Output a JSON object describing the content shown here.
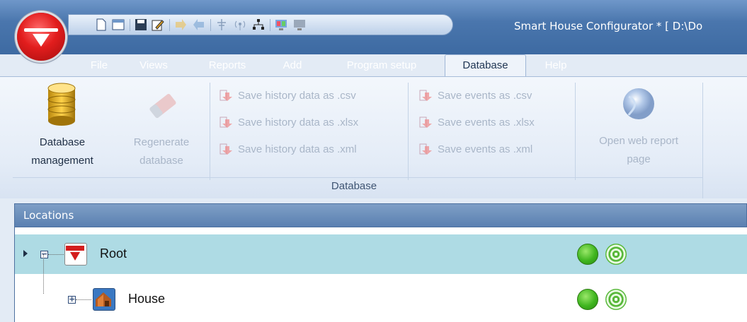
{
  "window": {
    "title": "Smart House Configurator * [ D:\\Do"
  },
  "qat": {
    "icons": [
      "new-document-icon",
      "open-icon",
      "save-icon",
      "edit-icon",
      "import-icon",
      "export-icon",
      "antenna-icon",
      "wireless-icon",
      "network-icon",
      "monitor-color-icon",
      "monitor-icon"
    ]
  },
  "menu": {
    "tabs": [
      {
        "label": "File"
      },
      {
        "label": "Views"
      },
      {
        "label": "Reports"
      },
      {
        "label": "Add"
      },
      {
        "label": "Program setup"
      },
      {
        "label": "Database"
      },
      {
        "label": "Help"
      }
    ],
    "active": "Database"
  },
  "ribbon": {
    "db_mgmt": {
      "line1": "Database",
      "line2": "management"
    },
    "regen": {
      "line1": "Regenerate",
      "line2": "database"
    },
    "history": [
      "Save history data as .csv",
      "Save history data as .xlsx",
      "Save history data as .xml"
    ],
    "events": [
      "Save events as .csv",
      "Save events as .xlsx",
      "Save events as .xml"
    ],
    "web": {
      "line1": "Open web report",
      "line2": "page"
    },
    "group_label": "Database"
  },
  "locations": {
    "header": "Locations",
    "nodes": [
      {
        "label": "Root",
        "expander": "−",
        "status": "online",
        "signal": "wireless"
      },
      {
        "label": "House",
        "expander": "+",
        "status": "online",
        "signal": "wireless"
      }
    ]
  },
  "colors": {
    "accent": "#4a76ad",
    "selection": "#aedbe4",
    "disabled_text": "#a9b6c8"
  }
}
